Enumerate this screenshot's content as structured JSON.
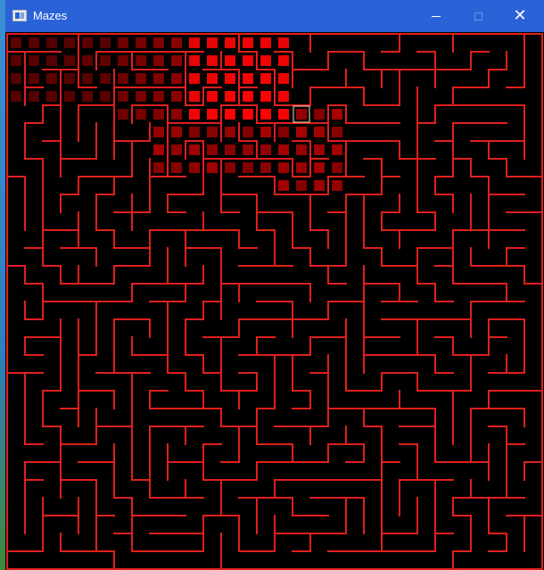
{
  "window": {
    "title": "Mazes",
    "icon": "app-window-icon",
    "controls": [
      {
        "name": "minimize",
        "icon": "minimize-icon"
      },
      {
        "name": "maximize",
        "icon": "maximize-icon"
      },
      {
        "name": "close",
        "icon": "close-icon",
        "glyph": "✕"
      }
    ]
  },
  "maze": {
    "columns": 30,
    "rows": 30,
    "wall_color": "#e0201c",
    "background_color": "#000000",
    "current_cell": {
      "col": 16,
      "row": 4
    }
  }
}
